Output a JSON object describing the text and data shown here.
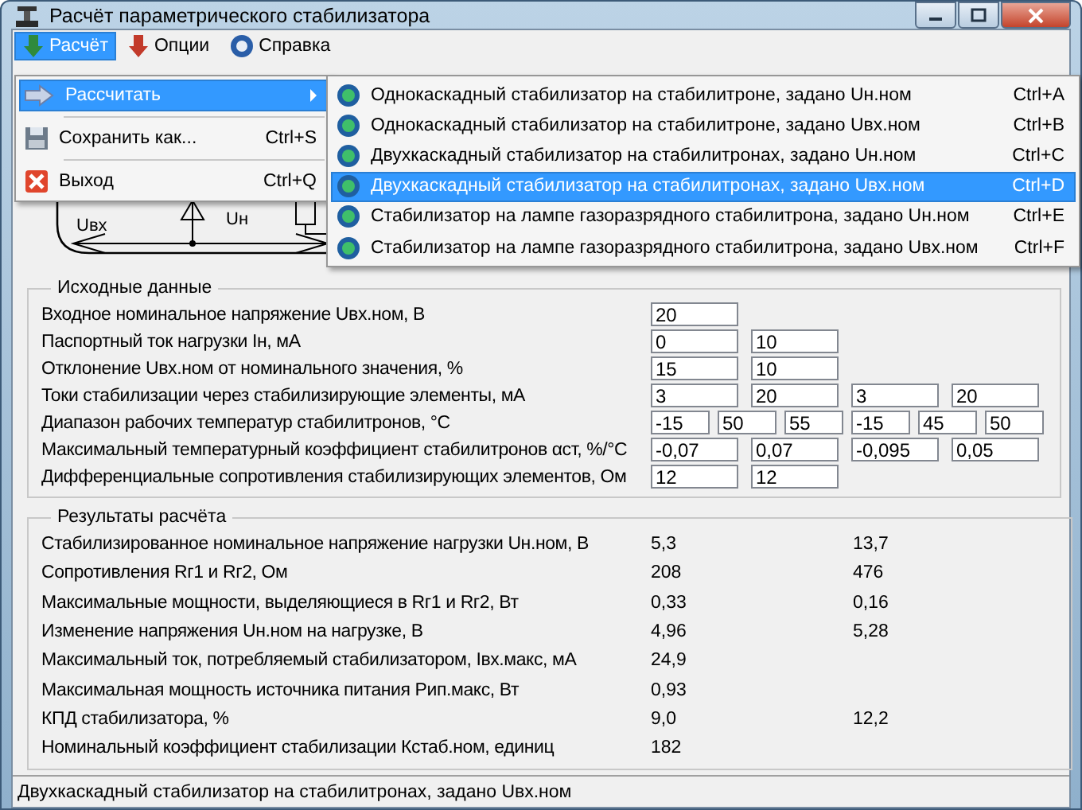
{
  "window": {
    "title": "Расчёт параметрического стабилизатора"
  },
  "menu_bar": [
    {
      "label": "Расчёт",
      "selected": true
    },
    {
      "label": "Опции",
      "selected": false
    },
    {
      "label": "Справка",
      "selected": false
    }
  ],
  "dropdown": [
    {
      "kind": "item",
      "label": "Рассчитать",
      "submenu": true,
      "selected": true
    },
    {
      "kind": "separator"
    },
    {
      "kind": "item",
      "label": "Сохранить как...",
      "shortcut": "Ctrl+S",
      "submenu": false,
      "selected": false
    },
    {
      "kind": "separator"
    },
    {
      "kind": "item",
      "label": "Выход",
      "shortcut": "Ctrl+Q",
      "submenu": false,
      "selected": false
    }
  ],
  "submenu": [
    {
      "label": "Однокаскадный стабилизатор на стабилитроне, задано Uн.ном",
      "shortcut": "Ctrl+A",
      "selected": false
    },
    {
      "label": "Однокаскадный стабилизатор на стабилитроне, задано Uвх.ном",
      "shortcut": "Ctrl+B",
      "selected": false
    },
    {
      "label": "Двухкаскадный стабилизатор на стабилитронах, задано Uн.ном",
      "shortcut": "Ctrl+C",
      "selected": false
    },
    {
      "label": "Двухкаскадный стабилизатор на стабилитронах, задано Uвх.ном",
      "shortcut": "Ctrl+D",
      "selected": true
    },
    {
      "label": "Стабилизатор на лампе газоразрядного стабилитрона, задано Uн.ном",
      "shortcut": "Ctrl+E",
      "selected": false
    },
    {
      "label": "Стабилизатор на лампе газоразрядного стабилитрона, задано Uвх.ном",
      "shortcut": "Ctrl+F",
      "selected": false
    }
  ],
  "circuit": {
    "labels": [
      "Uвх",
      "Uн"
    ]
  },
  "inputs": {
    "title": "Исходные данные",
    "rows": [
      {
        "label": "Входное номинальное напряжение Uвх.ном, В",
        "values": [
          "20"
        ]
      },
      {
        "label": "Паспортный ток нагрузки Iн, мА",
        "values": [
          "0",
          "10"
        ]
      },
      {
        "label": "Отклонение Uвх.ном от номинального значения, %",
        "values": [
          "15",
          "10"
        ]
      },
      {
        "label": "Токи стабилизации через стабилизирующие элементы, мА",
        "values": [
          "3",
          "20",
          "3",
          "20"
        ]
      },
      {
        "label": "Диапазон рабочих температур стабилитронов, °С",
        "values": [
          "-15",
          "50",
          "55",
          "-15",
          "45",
          "50"
        ]
      },
      {
        "label": "Максимальный температурный коэффициент стабилитронов αст, %/°С",
        "values": [
          "-0,07",
          "0,07",
          "-0,095",
          "0,05"
        ]
      },
      {
        "label": "Дифференциальные сопротивления стабилизирующих элементов, Ом",
        "values": [
          "12",
          "12"
        ]
      }
    ]
  },
  "results": {
    "title": "Результаты расчёта",
    "rows": [
      {
        "label": "Стабилизированное номинальное напряжение нагрузки Uн.ном, В",
        "values": [
          "5,3",
          "13,7"
        ]
      },
      {
        "label": "Сопротивления Rг1 и Rг2, Ом",
        "values": [
          "208",
          "476"
        ]
      },
      {
        "label": "Максимальные мощности, выделяющиеся в Rг1 и Rг2, Вт",
        "values": [
          "0,33",
          "0,16"
        ]
      },
      {
        "label": "Изменение напряжения Uн.ном на нагрузке, В",
        "values": [
          "4,96",
          "5,28"
        ]
      },
      {
        "label": "Максимальный ток, потребляемый стабилизатором, Iвх.макс, мА",
        "values": [
          "24,9"
        ]
      },
      {
        "label": "Максимальная мощность источника питания Рип.макс, Вт",
        "values": [
          "0,93"
        ]
      },
      {
        "label": "КПД стабилизатора, %",
        "values": [
          "9,0",
          "12,2"
        ]
      },
      {
        "label": "Номинальный коэффициент стабилизации Кстаб.ном, единиц",
        "values": [
          "182"
        ]
      }
    ]
  },
  "status_bar": "Двухкаскадный стабилизатор на стабилитронах, задано Uвх.ном"
}
